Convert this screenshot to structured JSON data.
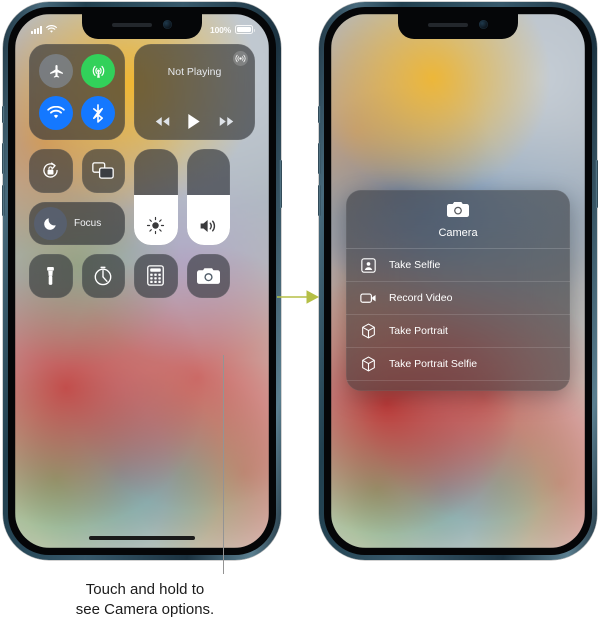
{
  "figure": {
    "caption_line1": "Touch and hold to",
    "caption_line2": "see Camera options.",
    "arrow_color": "#b5bf46",
    "callout_color": "#949494"
  },
  "left_phone": {
    "label": "iphone-control-center",
    "status_bar": {
      "cellular_icon": "cellular-bars-icon",
      "wifi_icon": "wifi-icon",
      "battery_percent": "100%",
      "battery_icon": "battery-full-icon"
    },
    "control_center": {
      "connectivity": {
        "airplane": {
          "name": "airplane-mode-toggle",
          "icon": "airplane-icon",
          "state": "off",
          "color": "#8796aa"
        },
        "cellular": {
          "name": "cellular-data-toggle",
          "icon": "cellular-antenna-icon",
          "state": "on",
          "color": "#32d15a"
        },
        "wifi": {
          "name": "wifi-toggle",
          "icon": "wifi-icon",
          "state": "on",
          "color": "#1478ff"
        },
        "bluetooth": {
          "name": "bluetooth-toggle",
          "icon": "bluetooth-icon",
          "state": "on",
          "color": "#1478ff"
        }
      },
      "media": {
        "title": "Not Playing",
        "airplay_icon": "airplay-audio-icon",
        "rewind_icon": "rewind-icon",
        "play_icon": "play-icon",
        "forward_icon": "fast-forward-icon"
      },
      "rotation_lock": {
        "label": "Rotation Lock",
        "icon": "rotation-lock-icon"
      },
      "screen_mirroring": {
        "label": "Screen Mirroring",
        "icon": "screen-mirroring-icon"
      },
      "focus": {
        "label": "Focus",
        "icon": "moon-icon"
      },
      "brightness": {
        "label": "Brightness",
        "icon": "brightness-icon",
        "value": 52
      },
      "volume": {
        "label": "Volume",
        "icon": "speaker-wave-icon",
        "value": 52
      },
      "flashlight": {
        "label": "Flashlight",
        "icon": "flashlight-icon"
      },
      "timer": {
        "label": "Timer",
        "icon": "timer-icon"
      },
      "calculator": {
        "label": "Calculator",
        "icon": "calculator-icon"
      },
      "camera": {
        "label": "Camera",
        "icon": "camera-icon"
      }
    },
    "home_indicator": "home-indicator"
  },
  "right_phone": {
    "label": "iphone-camera-quick-actions",
    "context_menu": {
      "app_icon": "camera-icon",
      "app_name": "Camera",
      "items": [
        {
          "label": "Take Selfie",
          "icon": "person-frame-icon"
        },
        {
          "label": "Record Video",
          "icon": "video-camera-icon"
        },
        {
          "label": "Take Portrait",
          "icon": "cube-icon"
        },
        {
          "label": "Take Portrait Selfie",
          "icon": "cube-icon"
        }
      ]
    }
  }
}
